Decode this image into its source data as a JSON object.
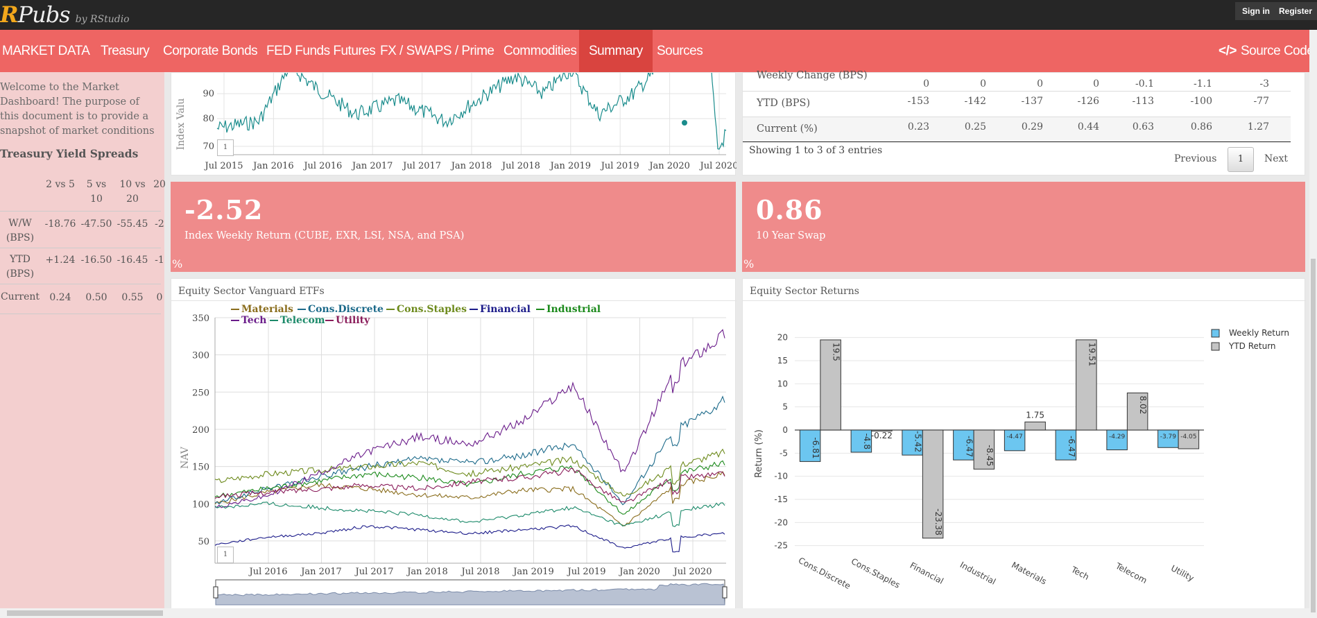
{
  "topbar": {
    "logo_r": "R",
    "logo_rest": "Pubs",
    "logo_by": "by RStudio",
    "sign_in": "Sign in",
    "register": "Register"
  },
  "nav": {
    "items": [
      "MARKET DATA",
      "Treasury",
      "Corporate Bonds",
      "FED Funds Futures",
      "FX / SWAPS / Prime",
      "Commodities",
      "Summary",
      "Sources"
    ],
    "source_code": "Source Code",
    "active": "Summary"
  },
  "sidebar": {
    "welcome": "Welcome to the Market Dashboard! The purpose of this document is to provide a snapshot of market conditions",
    "title": "Treasury Yield Spreads",
    "headers": [
      "2 vs 5",
      "5 vs 10",
      "10 vs 20",
      "20"
    ],
    "rows": [
      {
        "label": "W/W (BPS)",
        "values": [
          "-18.76",
          "-47.50",
          "-55.45",
          "-2"
        ]
      },
      {
        "label": "YTD (BPS)",
        "values": [
          "+1.24",
          "-16.50",
          "-16.45",
          "-1"
        ]
      },
      {
        "label": "Current",
        "values": [
          "0.24",
          "0.50",
          "0.55",
          "0"
        ]
      }
    ]
  },
  "index_chart": {
    "y_label": "Index Valu",
    "y_ticks": [
      "90",
      "80",
      "70"
    ],
    "x_ticks": [
      "Jul 2015",
      "Jan 2016",
      "Jul 2016",
      "Jan 2017",
      "Jul 2017",
      "Jan 2018",
      "Jul 2018",
      "Jan 2019",
      "Jul 2019",
      "Jan 2020",
      "Jul 2020"
    ],
    "reset": "1",
    "color": "#1a8c8c"
  },
  "table": {
    "rows": [
      {
        "label": "Weekly Change (BPS)",
        "values": [
          "0",
          "0",
          "0",
          "0",
          "-0.1",
          "-1.1",
          "-3"
        ]
      },
      {
        "label": "YTD (BPS)",
        "values": [
          "-153",
          "-142",
          "-137",
          "-126",
          "-113",
          "-100",
          "-77"
        ]
      },
      {
        "label": "Current (%)",
        "values": [
          "0.23",
          "0.25",
          "0.29",
          "0.44",
          "0.63",
          "0.86",
          "1.27"
        ]
      }
    ],
    "info": "Showing 1 to 3 of 3 entries",
    "previous": "Previous",
    "page": "1",
    "next": "Next"
  },
  "valuebox1": {
    "value": "-2.52",
    "label": "Index Weekly Return (CUBE, EXR, LSI, NSA, and PSA)",
    "icon": "%"
  },
  "valuebox2": {
    "value": "0.86",
    "label": "10 Year Swap",
    "icon": "%"
  },
  "etf_card": {
    "title": "Equity Sector Vanguard ETFs"
  },
  "sector_card": {
    "title": "Equity Sector Returns"
  },
  "etf_chart": {
    "ylabel": "NAV",
    "yticks": [
      "350",
      "300",
      "250",
      "200",
      "150",
      "100",
      "50"
    ],
    "xticks": [
      "Jul 2016",
      "Jan 2017",
      "Jul 2017",
      "Jan 2018",
      "Jul 2018",
      "Jan 2019",
      "Jul 2019",
      "Jan 2020",
      "Jul 2020"
    ],
    "reset": "1",
    "legend": [
      {
        "name": "Materials",
        "color": "#8a6d1c"
      },
      {
        "name": "Cons.Discrete",
        "color": "#1c6a8a"
      },
      {
        "name": "Cons.Staples",
        "color": "#6d8a1c"
      },
      {
        "name": "Financial",
        "color": "#1c1c8a"
      },
      {
        "name": "Industrial",
        "color": "#1c8a1c"
      },
      {
        "name": "Tech",
        "color": "#6a1c8a"
      },
      {
        "name": "Telecom",
        "color": "#1c8a6a"
      },
      {
        "name": "Utility",
        "color": "#8a1c5a"
      }
    ]
  },
  "chart_data": {
    "type": "bar",
    "categories": [
      "Cons.Discrete",
      "Cons.Staples",
      "Financial",
      "Industrial",
      "Materials",
      "Tech",
      "Telecom",
      "Utility"
    ],
    "series": [
      {
        "name": "Weekly Return",
        "values": [
          -6.81,
          -4.8,
          -5.42,
          -6.47,
          -4.47,
          -6.47,
          -4.29,
          -3.79
        ],
        "color": "#6cc6f0"
      },
      {
        "name": "YTD Return",
        "values": [
          19.5,
          -0.22,
          -23.38,
          -8.45,
          1.75,
          19.51,
          8.02,
          -4.05
        ],
        "color": "#c4c4c4"
      }
    ],
    "labels": [
      [
        "-6.81",
        "-4.8",
        "-5.42",
        "-6.47",
        "-4.47",
        "-6.47",
        "-4.29",
        "-3.79"
      ],
      [
        "19.5",
        "-0.22",
        "-23.38",
        "-8.45",
        "1.75",
        "19.51",
        "8.02",
        "-4.05"
      ]
    ],
    "ylabel": "Return (%)",
    "xlabel": "",
    "yticks": [
      20,
      15,
      10,
      5,
      0,
      -5,
      -10,
      -15,
      -20,
      -25
    ],
    "ylim": [
      -27,
      21
    ],
    "legend_position": "top-right"
  }
}
